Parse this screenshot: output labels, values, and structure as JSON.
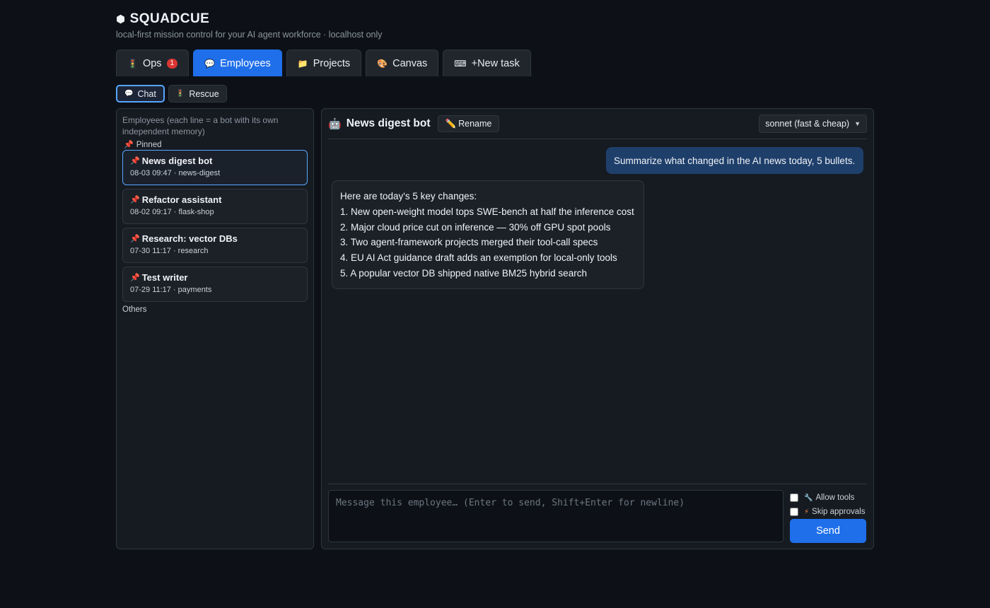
{
  "app": {
    "title": "SQUADCUE",
    "tagline": "local-first mission control for your AI agent workforce · localhost only"
  },
  "tabs": [
    {
      "label": "Ops",
      "icon": "traffic-light-icon",
      "badge": "1"
    },
    {
      "label": "Employees",
      "icon": "speech-bubble-icon",
      "active": true
    },
    {
      "label": "Projects",
      "icon": "folder-icon"
    },
    {
      "label": "Canvas",
      "icon": "palette-icon"
    },
    {
      "label": "New task",
      "icon": "keyboard-icon",
      "prefix": "+"
    }
  ],
  "subtabs": [
    {
      "label": "Chat",
      "icon": "speech-bubble-icon",
      "active": true
    },
    {
      "label": "Rescue",
      "icon": "traffic-light-icon"
    }
  ],
  "sidebar": {
    "description": "Employees (each line = a bot with its own independent memory)",
    "pinned_label": "Pinned",
    "others_label": "Others",
    "employees": [
      {
        "name": "News digest bot",
        "meta": "08-03 09:47 · news-digest",
        "active": true
      },
      {
        "name": "Refactor assistant",
        "meta": "08-02 09:17 · flask-shop"
      },
      {
        "name": "Research: vector DBs",
        "meta": "07-30 11:17 · research"
      },
      {
        "name": "Test writer",
        "meta": "07-29 11:17 · payments"
      }
    ]
  },
  "chat": {
    "title": "News digest bot",
    "rename_label": "Rename",
    "model": "sonnet (fast & cheap)",
    "messages": {
      "user": "Summarize what changed in the AI news today, 5 bullets.",
      "bot_lines": [
        "Here are today's 5 key changes:",
        "1. New open-weight model tops SWE-bench at half the inference cost",
        "2. Major cloud price cut on inference — 30% off GPU spot pools",
        "3. Two agent-framework projects merged their tool-call specs",
        "4. EU AI Act guidance draft adds an exemption for local-only tools",
        "5. A popular vector DB shipped native BM25 hybrid search"
      ]
    },
    "composer": {
      "placeholder": "Message this employee… (Enter to send, Shift+Enter for newline)",
      "allow_tools": "Allow tools",
      "skip_approvals": "Skip approvals",
      "send_label": "Send"
    }
  },
  "colors": {
    "accent": "#1f6feb",
    "background": "#0d1117",
    "panel": "#161b22",
    "badge": "#da3633",
    "user_bubble": "#1f3f6b"
  }
}
